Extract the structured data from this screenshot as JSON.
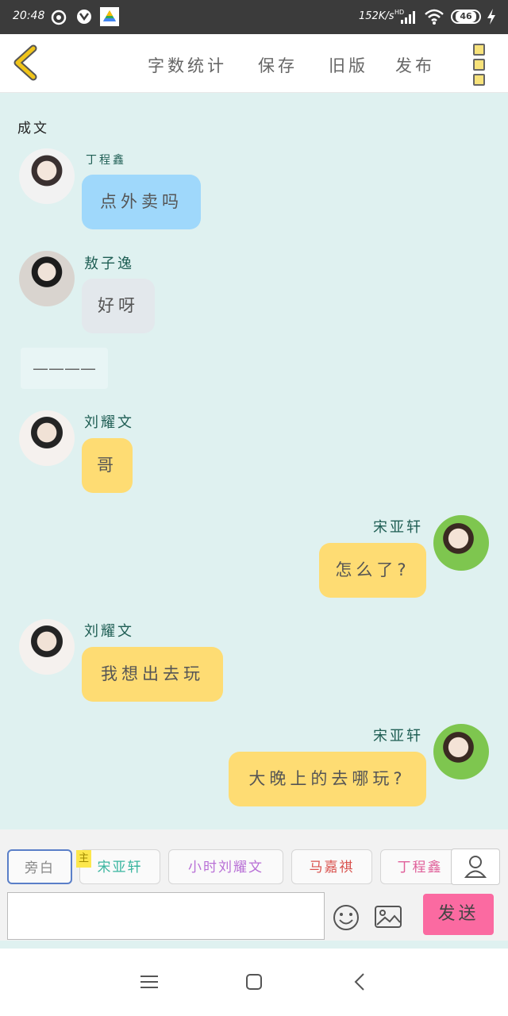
{
  "status_bar": {
    "time": "20:48",
    "speed": "152K/s",
    "battery": "46"
  },
  "toolbar": {
    "items": [
      "字数统计",
      "保存",
      "旧版",
      "发布"
    ]
  },
  "chat": {
    "narration_top": "成文",
    "divider": "————",
    "messages": [
      {
        "sender": "丁程鑫",
        "text": "点外卖吗",
        "side": "left",
        "style": "blue"
      },
      {
        "sender": "敖子逸",
        "text": "好呀",
        "side": "left",
        "style": "gray"
      },
      {
        "sender": "刘耀文",
        "text": "哥",
        "side": "left",
        "style": "yellow"
      },
      {
        "sender": "宋亚轩",
        "text": "怎么了?",
        "side": "right",
        "style": "yellow"
      },
      {
        "sender": "刘耀文",
        "text": "我想出去玩",
        "side": "left",
        "style": "yellow"
      },
      {
        "sender": "宋亚轩",
        "text": "大晚上的去哪玩?",
        "side": "right",
        "style": "yellow"
      }
    ]
  },
  "roles": {
    "main_tag": "主",
    "chips": [
      {
        "label": "旁白",
        "color": "#888888"
      },
      {
        "label": "宋亚轩",
        "color": "#3bb5a0"
      },
      {
        "label": "小时刘耀文",
        "color": "#b86fd6"
      },
      {
        "label": "马嘉祺",
        "color": "#d9534f"
      },
      {
        "label": "丁程鑫",
        "color": "#e0609a"
      }
    ]
  },
  "composer": {
    "input_value": "",
    "send_label": "发送"
  },
  "colors": {
    "chat_bg": "#dff1f0",
    "bubble_blue": "#9fd8fb",
    "bubble_gray": "#e3e8ec",
    "bubble_yellow": "#fedc73",
    "send_button": "#fb6aa1",
    "back_icon": "#f0c419"
  },
  "icons": [
    "weibo-icon",
    "app-icon",
    "google-drive-icon",
    "hd-signal-icon",
    "wifi-icon",
    "battery-icon",
    "charging-icon",
    "back-icon",
    "kebab-menu-icon",
    "user-icon",
    "emoji-icon",
    "image-icon",
    "menu-nav-icon",
    "home-nav-icon",
    "back-nav-icon"
  ]
}
